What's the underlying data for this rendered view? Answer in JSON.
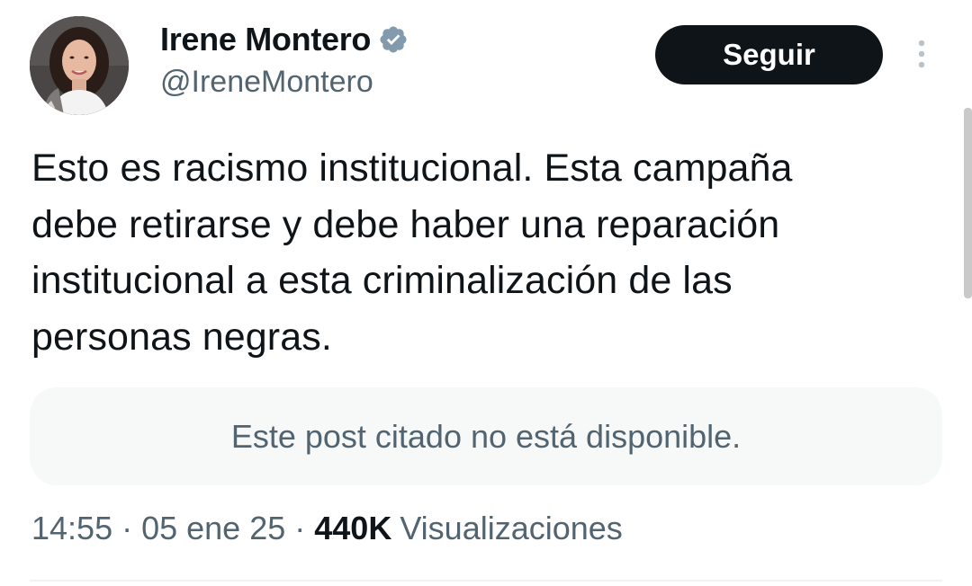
{
  "author": {
    "display_name": "Irene Montero",
    "handle": "@IreneMontero",
    "verified": true,
    "avatar_icon": "profile-photo"
  },
  "follow_button": {
    "label": "Seguir"
  },
  "more_menu": {
    "icon": "more-vertical-icon"
  },
  "tweet": {
    "text": "Esto es racismo institucional. Esta campaña\ndebe retirarse y debe haber una reparación\ninstitucional a esta criminalización de las\npersonas negras."
  },
  "quote": {
    "text": "Este post citado no está disponible."
  },
  "meta": {
    "time": "14:55",
    "separator": "·",
    "date": "05 ene 25",
    "views_count": "440K",
    "views_label": "Visualizaciones"
  },
  "colors": {
    "text_primary": "#0f1419",
    "text_secondary": "#536471",
    "verified_badge": "#829aab",
    "follow_button_bg": "#0f1419",
    "quote_bg": "#f7f9f9"
  }
}
